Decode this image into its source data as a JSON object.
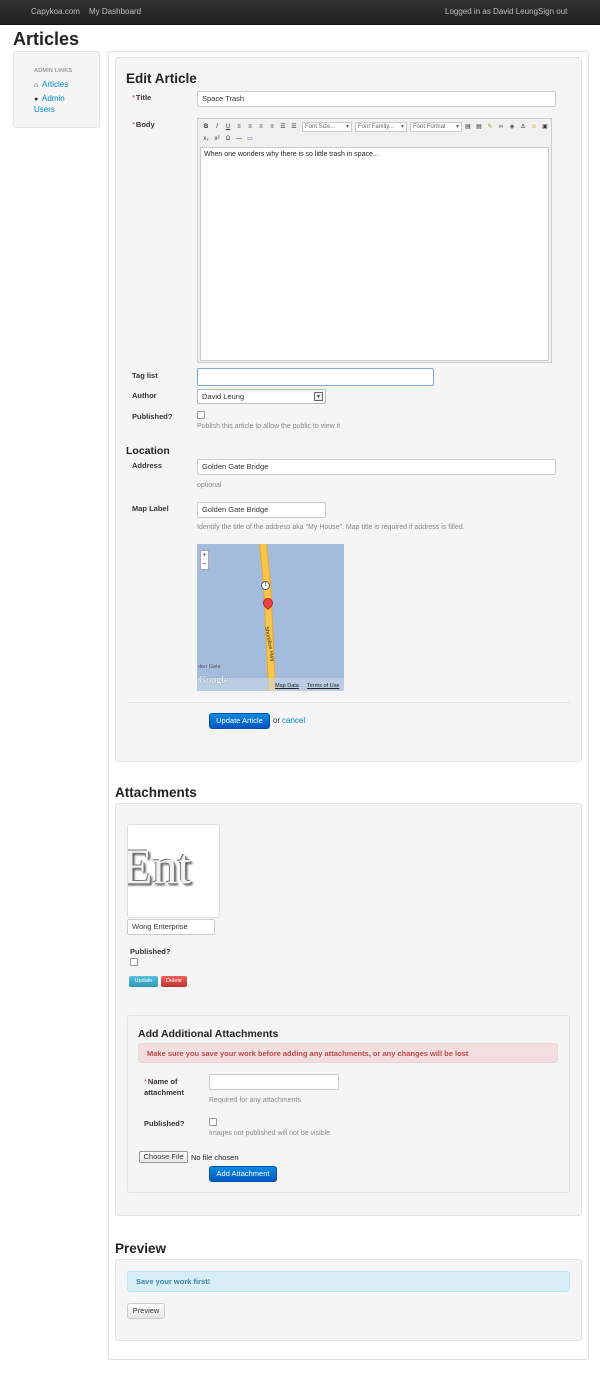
{
  "topbar": {
    "brand": "Capykoa.com",
    "dashboard": "My Dashboard",
    "user": "Logged in as David Leung",
    "signout": "Sign out"
  },
  "page_title": "Articles",
  "sidebar": {
    "header": "ADMIN LINKS",
    "articles": "Articles",
    "admin_users_1": "Admin",
    "admin_users_2": "Users"
  },
  "edit": {
    "heading": "Edit Article",
    "title_label": "Title",
    "title_value": "Space Trash",
    "body_label": "Body",
    "body_text": "When one wonders why there is so little trash in space...",
    "toolbar": {
      "font_size": "Font Size...",
      "font_family": "Font Family...",
      "font_format": "Font Format"
    },
    "tag_label": "Tag list",
    "tag_value": "",
    "author_label": "Author",
    "author_value": "David Leung",
    "published_label": "Published?",
    "published_help": "Publish this article to allow the public to view it",
    "location_heading": "Location",
    "address_label": "Address",
    "address_value": "Golden Gate Bridge",
    "address_help": "optional",
    "maplabel_label": "Map Label",
    "maplabel_value": "Golden Gate Bridge",
    "maplabel_help": "Identify the title of the address aka \"My House\". Map title is required if address is filled.",
    "map": {
      "road": "Shoreline Hwy",
      "route": "1",
      "place": "den Gate",
      "logo": "Google",
      "data_link": "Map Data",
      "terms_link": "Terms of Use"
    },
    "submit": "Update Article",
    "or": "or",
    "cancel": "cancel"
  },
  "attachments": {
    "heading": "Attachments",
    "thumb_text": "Ent",
    "name_value": "Wong Enterprise",
    "published_label": "Published?",
    "update": "Update",
    "delete": "Delete",
    "add_heading": "Add Additional Attachments",
    "warning": "Make sure you save your work before adding any attachments, or any changes will be lost",
    "name_label_1": "Name of",
    "name_label_2": "attachment",
    "name_help": "Required for any attachments",
    "pub_label": "Published?",
    "pub_help": "Images not published will not be visible.",
    "choose_file": "Choose File",
    "no_file": "No file chosen",
    "add_button": "Add Attachment"
  },
  "preview": {
    "heading": "Preview",
    "info": "Save your work first!",
    "button": "Preview"
  },
  "colors": {
    "primary": "#0663c9",
    "danger": "#d9534f",
    "info": "#5bc0de",
    "link": "#0088cc"
  }
}
